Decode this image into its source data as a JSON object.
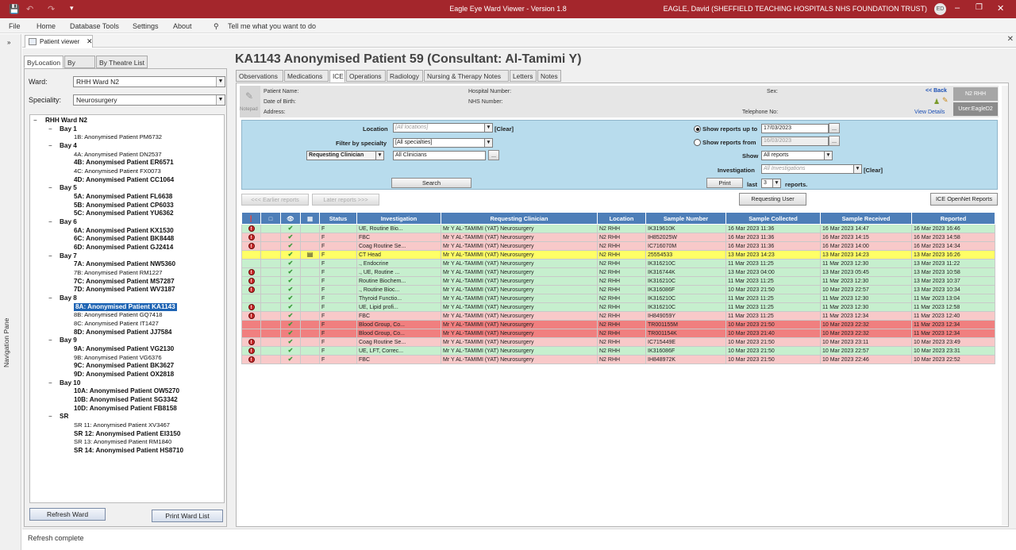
{
  "window": {
    "title": "Eagle Eye Ward Viewer - Version 1.8",
    "user": "EAGLE, David (SHEFFIELD TEACHING HOSPITALS NHS FOUNDATION TRUST)",
    "initials": "ED",
    "accent": "#a4262c"
  },
  "menu": {
    "file": "File",
    "home": "Home",
    "database_tools": "Database Tools",
    "settings": "Settings",
    "about": "About",
    "tell_me": "Tell me what you want to do"
  },
  "nav_pane": {
    "label": "Navigation Pane"
  },
  "doc_tab": {
    "label": "Patient viewer"
  },
  "left": {
    "tabs": [
      "ByLocation",
      "By Clinic",
      "By Theatre List"
    ],
    "ward_label": "Ward:",
    "ward_value": "RHH Ward N2",
    "speciality_label": "Speciality:",
    "speciality_value": "Neurosurgery",
    "tree": {
      "root": "RHH Ward N2",
      "bays": [
        {
          "name": "Bay 1",
          "beds": [
            {
              "label": "1B: Anonymised Patient PM6732",
              "bold": false
            }
          ]
        },
        {
          "name": "Bay 4",
          "beds": [
            {
              "label": "4A: Anonymised Patient DN2537",
              "bold": false
            },
            {
              "label": "4B: Anonymised Patient ER6571",
              "bold": true
            },
            {
              "label": "4C: Anonymised Patient FX0073",
              "bold": false
            },
            {
              "label": "4D: Anonymised Patient CC1064",
              "bold": true
            }
          ]
        },
        {
          "name": "Bay 5",
          "beds": [
            {
              "label": "5A: Anonymised Patient FL6638",
              "bold": true
            },
            {
              "label": "5B: Anonymised Patient CP6033",
              "bold": true
            },
            {
              "label": "5C: Anonymised Patient YU6362",
              "bold": true
            }
          ]
        },
        {
          "name": "Bay 6",
          "beds": [
            {
              "label": "6A: Anonymised Patient KX1530",
              "bold": true
            },
            {
              "label": "6C: Anonymised Patient BK8448",
              "bold": true
            },
            {
              "label": "6D: Anonymised Patient GJ2414",
              "bold": true
            }
          ]
        },
        {
          "name": "Bay 7",
          "beds": [
            {
              "label": "7A: Anonymised Patient NW5360",
              "bold": true
            },
            {
              "label": "7B: Anonymised Patient RM1227",
              "bold": false
            },
            {
              "label": "7C: Anonymised Patient MS7287",
              "bold": true
            },
            {
              "label": "7D: Anonymised Patient WV3187",
              "bold": true
            }
          ]
        },
        {
          "name": "Bay 8",
          "beds": [
            {
              "label": "8A: Anonymised Patient KA1143",
              "bold": true,
              "selected": true
            },
            {
              "label": "8B: Anonymised Patient GQ7418",
              "bold": false
            },
            {
              "label": "8C: Anonymised Patient IT1427",
              "bold": false
            },
            {
              "label": "8D: Anonymised Patient JJ7584",
              "bold": true
            }
          ]
        },
        {
          "name": "Bay 9",
          "beds": [
            {
              "label": "9A: Anonymised Patient VG2130",
              "bold": true
            },
            {
              "label": "9B: Anonymised Patient VG6376",
              "bold": false
            },
            {
              "label": "9C: Anonymised Patient BK3627",
              "bold": true
            },
            {
              "label": "9D: Anonymised Patient OX2818",
              "bold": true
            }
          ]
        },
        {
          "name": "Bay 10",
          "beds": [
            {
              "label": "10A: Anonymised Patient OW5270",
              "bold": true
            },
            {
              "label": "10B: Anonymised Patient SG3342",
              "bold": true
            },
            {
              "label": "10D: Anonymised Patient FB8158",
              "bold": true
            }
          ]
        },
        {
          "name": "SR",
          "beds": [
            {
              "label": "SR 11: Anonymised Patient XV3467",
              "bold": false
            },
            {
              "label": "SR 12: Anonymised Patient EI3150",
              "bold": true
            },
            {
              "label": "SR 13: Anonymised Patient RM1840",
              "bold": false
            },
            {
              "label": "SR 14: Anonymised Patient HS8710",
              "bold": true
            }
          ]
        }
      ]
    },
    "refresh_button": "Refresh Ward",
    "print_button": "Print Ward List"
  },
  "patient": {
    "title": "KA1143 Anonymised Patient 59 (Consultant: Al-Tamimi Y)",
    "tabs": [
      "Observations",
      "Medications",
      "ICE",
      "Operations",
      "Radiology",
      "Nursing & Therapy Notes",
      "Letters",
      "Notes"
    ],
    "active_tab": "ICE",
    "info": {
      "notepad": "Notepad",
      "name_label": "Patient Name:",
      "dob_label": "Date of Birth:",
      "address_label": "Address:",
      "hospital_label": "Hospital Number:",
      "nhs_label": "NHS Number:",
      "sex_label": "Sex:",
      "telephone_label": "Telephone No:",
      "back_link": "<< Back",
      "view_details": "View Details",
      "ward_badge": "N2 RHH",
      "user_badge": "User:EagleD2"
    }
  },
  "filters": {
    "location_label": "Location",
    "location_value": "[All locations]",
    "clear1": "[Clear]",
    "specialty_label": "Filter by specialty",
    "specialty_value": "[All specialties]",
    "clinician_type": "Requesting Clinician",
    "clinician_value": "All Clinicians",
    "search_button": "Search",
    "show_upto_label": "Show reports up to",
    "show_upto_value": "17/03/2023",
    "show_from_label": "Show reports from",
    "show_from_value": "16/03/2023",
    "show_label": "Show",
    "show_value": "All reports",
    "investigation_label": "Investigation",
    "investigation_value": "All Investigations",
    "clear2": "[Clear]",
    "print_button": "Print",
    "last_label": "last",
    "last_value": "3",
    "reports_label": "reports."
  },
  "buttons": {
    "earlier": "<<< Earlier reports",
    "later": "Later reports >>>",
    "requesting_user": "Requesting User",
    "ice_openet": "ICE OpenNet Reports"
  },
  "grid": {
    "headers": [
      "!",
      "",
      "",
      "",
      "Status",
      "Investigation",
      "Requesting Clinician",
      "Location",
      "Sample Number",
      "Sample Collected",
      "Sample Received",
      "Reported"
    ],
    "header_icons": [
      "exclamation-icon",
      "page-icon",
      "eye-icon",
      "document-icon"
    ],
    "rows": [
      {
        "color": "g",
        "alert": true,
        "seen": true,
        "doc": false,
        "status": "F",
        "inv": "UE, Routine Bio...",
        "clin": "Mr Y AL-TAMIMI (YAT) Neurosurgery",
        "loc": "N2 RHH",
        "num": "IK319610K",
        "col": "16 Mar 2023 11:36",
        "rec": "16 Mar 2023 14:47",
        "rep": "16 Mar 2023 16:46"
      },
      {
        "color": "p",
        "alert": true,
        "seen": true,
        "doc": false,
        "status": "F",
        "inv": "FBC",
        "clin": "Mr Y AL-TAMIMI (YAT) Neurosurgery",
        "loc": "N2 RHH",
        "num": "IH852025W",
        "col": "16 Mar 2023 11:36",
        "rec": "16 Mar 2023 14:15",
        "rep": "16 Mar 2023 14:58"
      },
      {
        "color": "p",
        "alert": true,
        "seen": true,
        "doc": false,
        "status": "F",
        "inv": "Coag Routine Se...",
        "clin": "Mr Y AL-TAMIMI (YAT) Neurosurgery",
        "loc": "N2 RHH",
        "num": "IC716070M",
        "col": "16 Mar 2023 11:36",
        "rec": "16 Mar 2023 14:00",
        "rep": "16 Mar 2023 14:34"
      },
      {
        "color": "y",
        "alert": false,
        "seen": true,
        "doc": true,
        "status": "F",
        "inv": "CT Head",
        "clin": "Mr Y AL-TAMIMI (YAT) Neurosurgery",
        "loc": "N2 RHH",
        "num": "25554533",
        "col": "13 Mar 2023 14:23",
        "rec": "13 Mar 2023 14:23",
        "rep": "13 Mar 2023 16:26"
      },
      {
        "color": "g",
        "alert": false,
        "seen": true,
        "doc": false,
        "status": "F",
        "inv": "., Endocrine",
        "clin": "Mr Y AL-TAMIMI (YAT) Neurosurgery",
        "loc": "N2 RHH",
        "num": "IK316210C",
        "col": "11 Mar 2023 11:25",
        "rec": "11 Mar 2023 12:30",
        "rep": "13 Mar 2023 11:22"
      },
      {
        "color": "g",
        "alert": true,
        "seen": true,
        "doc": false,
        "status": "F",
        "inv": "., UE, Routine ...",
        "clin": "Mr Y AL-TAMIMI (YAT) Neurosurgery",
        "loc": "N2 RHH",
        "num": "IK316744K",
        "col": "13 Mar 2023 04:00",
        "rec": "13 Mar 2023 05:45",
        "rep": "13 Mar 2023 10:58"
      },
      {
        "color": "g",
        "alert": true,
        "seen": true,
        "doc": false,
        "status": "F",
        "inv": "Routine Biochem...",
        "clin": "Mr Y AL-TAMIMI (YAT) Neurosurgery",
        "loc": "N2 RHH",
        "num": "IK316210C",
        "col": "11 Mar 2023 11:25",
        "rec": "11 Mar 2023 12:30",
        "rep": "13 Mar 2023 10:37"
      },
      {
        "color": "g",
        "alert": true,
        "seen": true,
        "doc": false,
        "status": "F",
        "inv": "., Routine Bioc...",
        "clin": "Mr Y AL-TAMIMI (YAT) Neurosurgery",
        "loc": "N2 RHH",
        "num": "IK316086F",
        "col": "10 Mar 2023 21:50",
        "rec": "10 Mar 2023 22:57",
        "rep": "13 Mar 2023 10:34"
      },
      {
        "color": "g",
        "alert": false,
        "seen": true,
        "doc": false,
        "status": "F",
        "inv": "Thyroid Functio...",
        "clin": "Mr Y AL-TAMIMI (YAT) Neurosurgery",
        "loc": "N2 RHH",
        "num": "IK316210C",
        "col": "11 Mar 2023 11:25",
        "rec": "11 Mar 2023 12:30",
        "rep": "11 Mar 2023 13:04"
      },
      {
        "color": "g",
        "alert": true,
        "seen": true,
        "doc": false,
        "status": "F",
        "inv": "UE, Lipid profi...",
        "clin": "Mr Y AL-TAMIMI (YAT) Neurosurgery",
        "loc": "N2 RHH",
        "num": "IK316210C",
        "col": "11 Mar 2023 11:25",
        "rec": "11 Mar 2023 12:30",
        "rep": "11 Mar 2023 12:58"
      },
      {
        "color": "p",
        "alert": true,
        "seen": true,
        "doc": false,
        "status": "F",
        "inv": "FBC",
        "clin": "Mr Y AL-TAMIMI (YAT) Neurosurgery",
        "loc": "N2 RHH",
        "num": "IH849059Y",
        "col": "11 Mar 2023 11:25",
        "rec": "11 Mar 2023 12:34",
        "rep": "11 Mar 2023 12:40"
      },
      {
        "color": "r",
        "alert": false,
        "seen": true,
        "doc": false,
        "status": "F",
        "inv": "Blood Group, Co...",
        "clin": "Mr Y AL-TAMIMI (YAT) Neurosurgery",
        "loc": "N2 RHH",
        "num": "TR001155M",
        "col": "10 Mar 2023 21:50",
        "rec": "10 Mar 2023 22:32",
        "rep": "11 Mar 2023 12:34"
      },
      {
        "color": "r",
        "alert": false,
        "seen": true,
        "doc": false,
        "status": "F",
        "inv": "Blood Group, Co...",
        "clin": "Mr Y AL-TAMIMI (YAT) Neurosurgery",
        "loc": "N2 RHH",
        "num": "TR001154K",
        "col": "10 Mar 2023 21:40",
        "rec": "10 Mar 2023 22:32",
        "rep": "11 Mar 2023 12:34"
      },
      {
        "color": "p",
        "alert": true,
        "seen": true,
        "doc": false,
        "status": "F",
        "inv": "Coag Routine Se...",
        "clin": "Mr Y AL-TAMIMI (YAT) Neurosurgery",
        "loc": "N2 RHH",
        "num": "IC715449E",
        "col": "10 Mar 2023 21:50",
        "rec": "10 Mar 2023 23:11",
        "rep": "10 Mar 2023 23:49"
      },
      {
        "color": "g",
        "alert": true,
        "seen": true,
        "doc": false,
        "status": "F",
        "inv": "UE, LFT, Correc...",
        "clin": "Mr Y AL-TAMIMI (YAT) Neurosurgery",
        "loc": "N2 RHH",
        "num": "IK316086F",
        "col": "10 Mar 2023 21:50",
        "rec": "10 Mar 2023 22:57",
        "rep": "10 Mar 2023 23:31"
      },
      {
        "color": "p",
        "alert": true,
        "seen": true,
        "doc": false,
        "status": "F",
        "inv": "FBC",
        "clin": "Mr Y AL-TAMIMI (YAT) Neurosurgery",
        "loc": "N2 RHH",
        "num": "IH848972K",
        "col": "10 Mar 2023 21:50",
        "rec": "10 Mar 2023 22:46",
        "rep": "10 Mar 2023 22:52"
      }
    ]
  },
  "statusbar": {
    "text": "Refresh complete"
  }
}
